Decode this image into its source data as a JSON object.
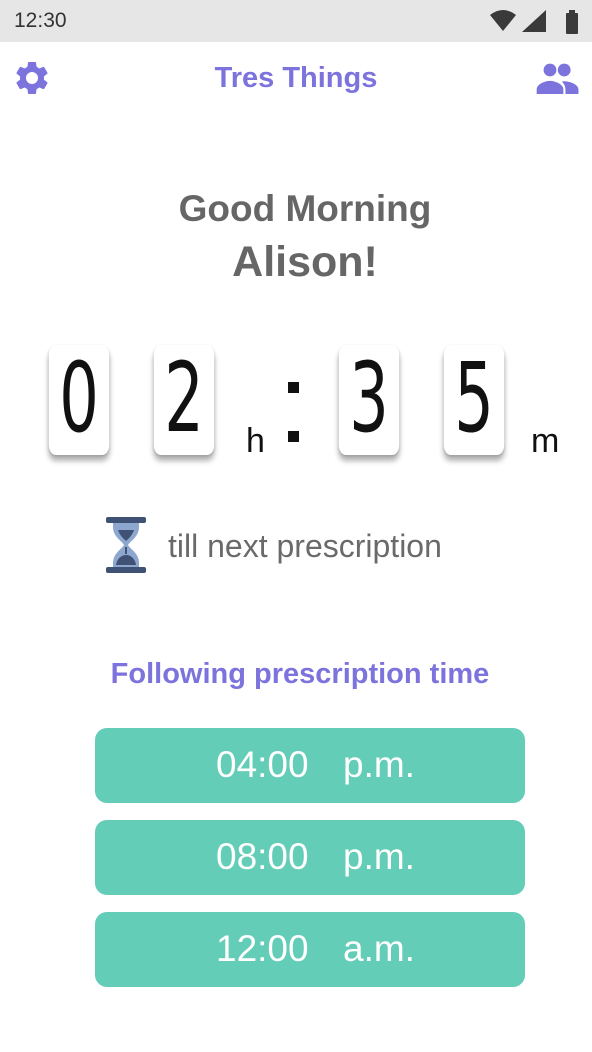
{
  "status_bar": {
    "time": "12:30",
    "icons": [
      "wifi-icon",
      "signal-icon",
      "battery-icon"
    ]
  },
  "app_bar": {
    "title": "Tres Things",
    "left_icon": "gear-icon",
    "right_icon": "people-icon",
    "accent_color": "#7c73dc"
  },
  "greeting": {
    "line1": "Good Morning",
    "line2": "Alison!"
  },
  "countdown": {
    "hours": [
      "0",
      "2"
    ],
    "hours_unit": "h",
    "minutes": [
      "3",
      "5"
    ],
    "minutes_unit": "m"
  },
  "till_next": {
    "icon": "hourglass-icon",
    "text": "till next prescription"
  },
  "following": {
    "title": "Following prescription time",
    "button_color": "#64cdb7",
    "times": [
      {
        "time": "04:00",
        "period": "p.m."
      },
      {
        "time": "08:00",
        "period": "p.m."
      },
      {
        "time": "12:00",
        "period": "a.m."
      }
    ]
  }
}
